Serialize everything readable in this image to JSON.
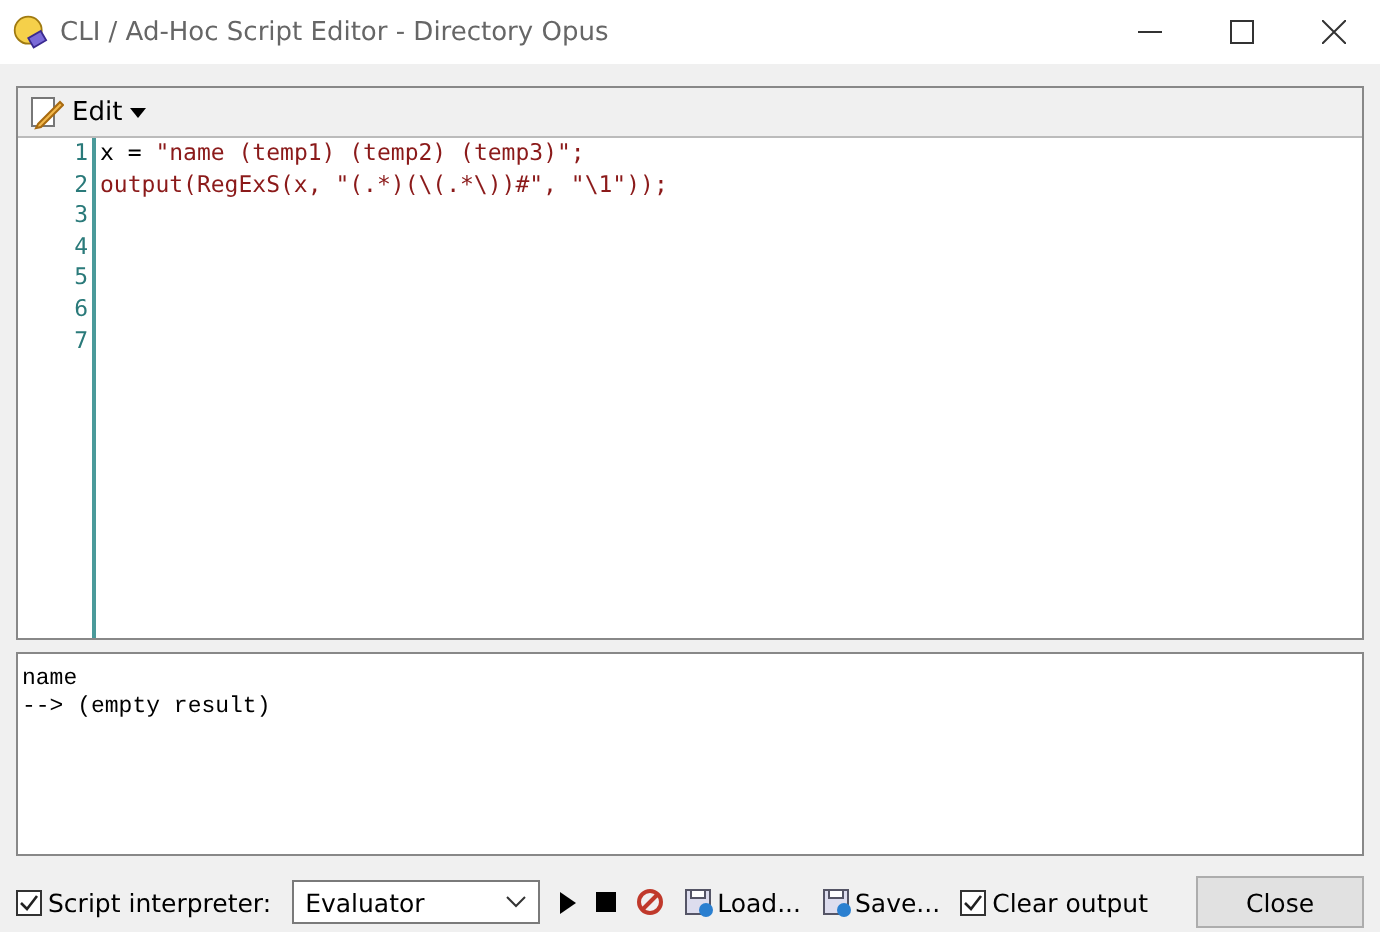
{
  "window": {
    "title": "CLI / Ad-Hoc Script Editor - Directory Opus"
  },
  "toolbar": {
    "menu_label": "Edit"
  },
  "editor": {
    "lines": [
      {
        "number": "1",
        "segments": [
          {
            "text": "x = ",
            "kind": "plain"
          },
          {
            "text": "\"name (temp1) (temp2) (temp3)\";",
            "kind": "string"
          }
        ]
      },
      {
        "number": "2",
        "segments": [
          {
            "text": "output(RegExS(x, \"(.*)(\\(.*\\))#\", \"\\1\"));",
            "kind": "string"
          }
        ]
      },
      {
        "number": "3"
      },
      {
        "number": "4"
      },
      {
        "number": "5"
      },
      {
        "number": "6"
      },
      {
        "number": "7"
      }
    ]
  },
  "output": {
    "lines": [
      "name",
      "--> (empty result)"
    ]
  },
  "bottom_bar": {
    "script_interpreter": {
      "label": "Script interpreter:",
      "checked": true
    },
    "interpreter_value": "Evaluator",
    "load_label": "Load...",
    "save_label": "Save...",
    "clear_output": {
      "label": "Clear output",
      "checked": true
    },
    "close_label": "Close"
  }
}
